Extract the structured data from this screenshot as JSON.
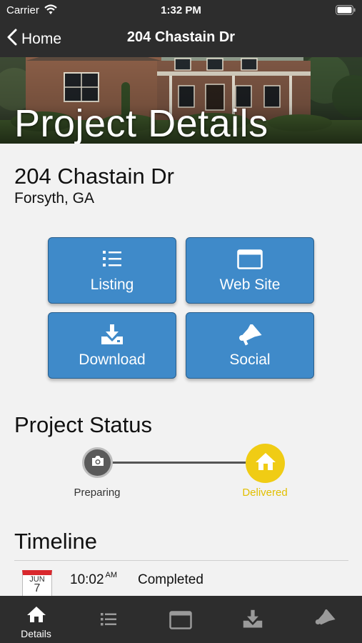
{
  "status_bar": {
    "carrier": "Carrier",
    "time": "1:32 PM"
  },
  "nav": {
    "back_label": "Home",
    "title": "204 Chastain Dr"
  },
  "hero": {
    "title": "Project Details"
  },
  "property": {
    "address": "204 Chastain Dr",
    "city": "Forsyth, GA"
  },
  "actions": [
    {
      "label": "Listing",
      "icon": "list-icon"
    },
    {
      "label": "Web Site",
      "icon": "browser-window-icon"
    },
    {
      "label": "Download",
      "icon": "download-tray-icon"
    },
    {
      "label": "Social",
      "icon": "megaphone-icon"
    }
  ],
  "project_status": {
    "title": "Project Status",
    "steps": [
      {
        "label": "Preparing",
        "icon": "camera-icon",
        "color": "#5a5a5a",
        "state": "done"
      },
      {
        "label": "Delivered",
        "icon": "house-icon",
        "color": "#f0cc14",
        "state": "current"
      }
    ]
  },
  "timeline": {
    "title": "Timeline",
    "entries": [
      {
        "month": "JUN",
        "day": "7",
        "time": "10:02",
        "ampm": "AM",
        "text": "Completed"
      }
    ]
  },
  "tabbar": {
    "active_label": "Details",
    "tabs": [
      {
        "icon": "house-icon",
        "label": "Details",
        "active": true
      },
      {
        "icon": "list-icon"
      },
      {
        "icon": "browser-window-icon"
      },
      {
        "icon": "download-tray-icon"
      },
      {
        "icon": "megaphone-icon"
      }
    ]
  },
  "colors": {
    "bar_bg": "#2d2d2d",
    "button_blue": "#3f8ac9",
    "delivered_yellow": "#f0cc14",
    "page_bg": "#f2f2f2"
  }
}
